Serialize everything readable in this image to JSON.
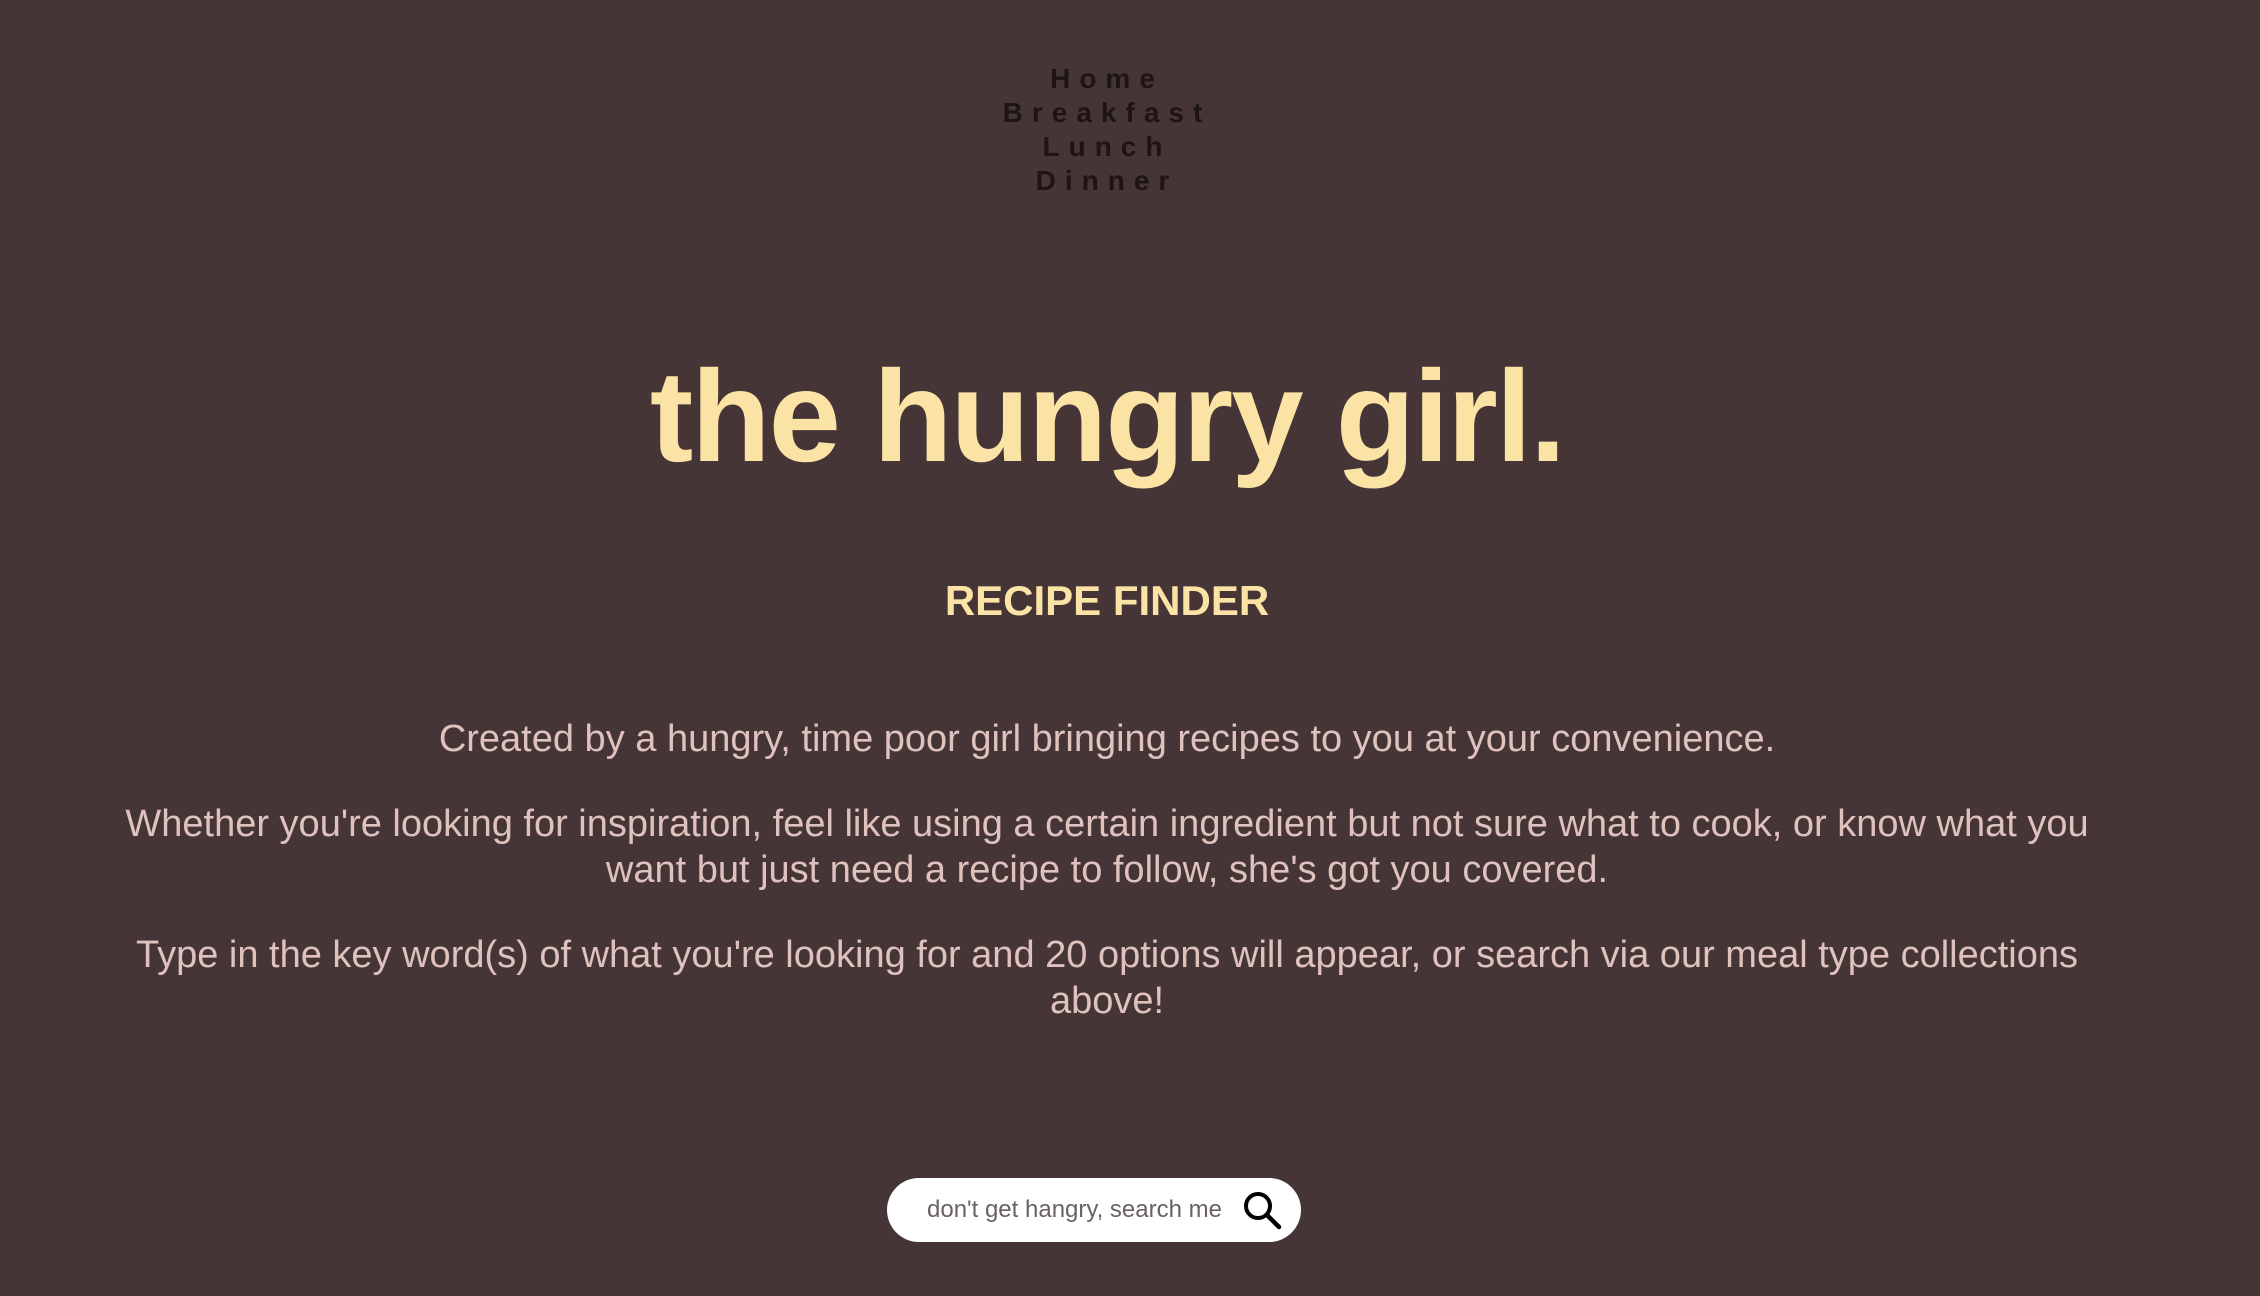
{
  "nav": {
    "items": [
      {
        "label": "Home"
      },
      {
        "label": "Breakfast"
      },
      {
        "label": "Lunch"
      },
      {
        "label": "Dinner"
      }
    ]
  },
  "hero": {
    "brand": "the hungry girl.",
    "subtitle": "RECIPE FINDER"
  },
  "intro": {
    "paragraphs": [
      "Created by a hungry, time poor girl bringing recipes to you at your convenience.",
      "Whether you're looking for inspiration, feel like using a certain ingredient but not sure what to cook, or know what you want but just need a recipe to follow, she's got you covered.",
      "Type in the key word(s) of what you're looking for and 20 options will appear, or search via our meal type collections above!"
    ]
  },
  "search": {
    "value": "",
    "placeholder": "don't get hangry, search me",
    "icon": "search-icon"
  },
  "colors": {
    "background": "#463536",
    "accent": "#fbe3a6",
    "body_text": "#dfc1bd",
    "nav_text": "#1d1414"
  }
}
